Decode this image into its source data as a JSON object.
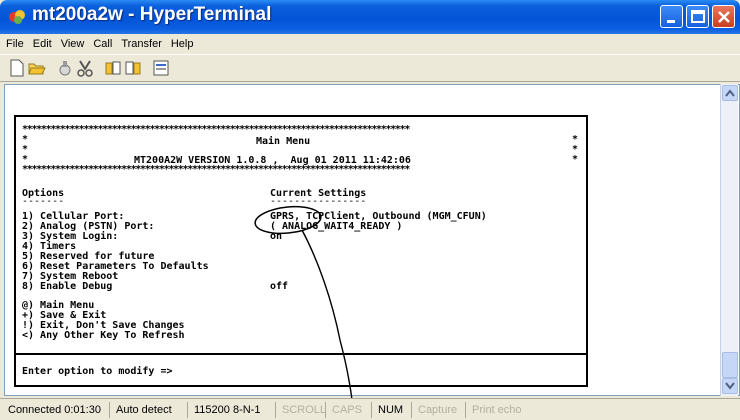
{
  "window": {
    "title": "mt200a2w - HyperTerminal"
  },
  "menu": [
    "File",
    "Edit",
    "View",
    "Call",
    "Transfer",
    "Help"
  ],
  "toolbar": {
    "icons": [
      "new-connection-icon",
      "open-icon",
      "disconnect-icon",
      "properties-icon",
      "send-icon",
      "receive-icon",
      "properties-sheet-icon"
    ]
  },
  "terminal": {
    "stars_line": "**********************************************************************************",
    "menu_title": "Main Menu",
    "version_line": "MT200A2W VERSION 1.0.8 ,  Aug 01 2011 11:42:06",
    "options_header": "Options",
    "options_rule": "-------",
    "settings_header": "Current Settings",
    "settings_rule": "----------------",
    "options": [
      {
        "label": "1) Cellular Port:",
        "value": "GPRS, TCPClient, Outbound (MGM_CFUN)"
      },
      {
        "label": "2) Analog (PSTN) Port:",
        "value": "( ANALOG_WAIT4_READY )"
      },
      {
        "label": "3) System Login:",
        "value": "on"
      },
      {
        "label": "4) Timers",
        "value": ""
      },
      {
        "label": "5) Reserved for future",
        "value": ""
      },
      {
        "label": "6) Reset Parameters To Defaults",
        "value": ""
      },
      {
        "label": "7) System Reboot",
        "value": ""
      },
      {
        "label": "8) Enable Debug",
        "value": "off"
      }
    ],
    "commands": [
      "@) Main Menu",
      "+) Save & Exit",
      "!) Exit, Don't Save Changes",
      "<) Any Other Key To Refresh"
    ],
    "prompt": "Enter option to modify =>"
  },
  "statusbar": {
    "connected": "Connected 0:01:30",
    "detect": "Auto detect",
    "baud": "115200 8-N-1",
    "scroll": "SCROLL",
    "caps": "CAPS",
    "num": "NUM",
    "capture": "Capture",
    "print_echo": "Print echo"
  },
  "colors": {
    "titlebar": "#0554d8",
    "close_button": "#c8401e",
    "annotation": "#000000"
  }
}
